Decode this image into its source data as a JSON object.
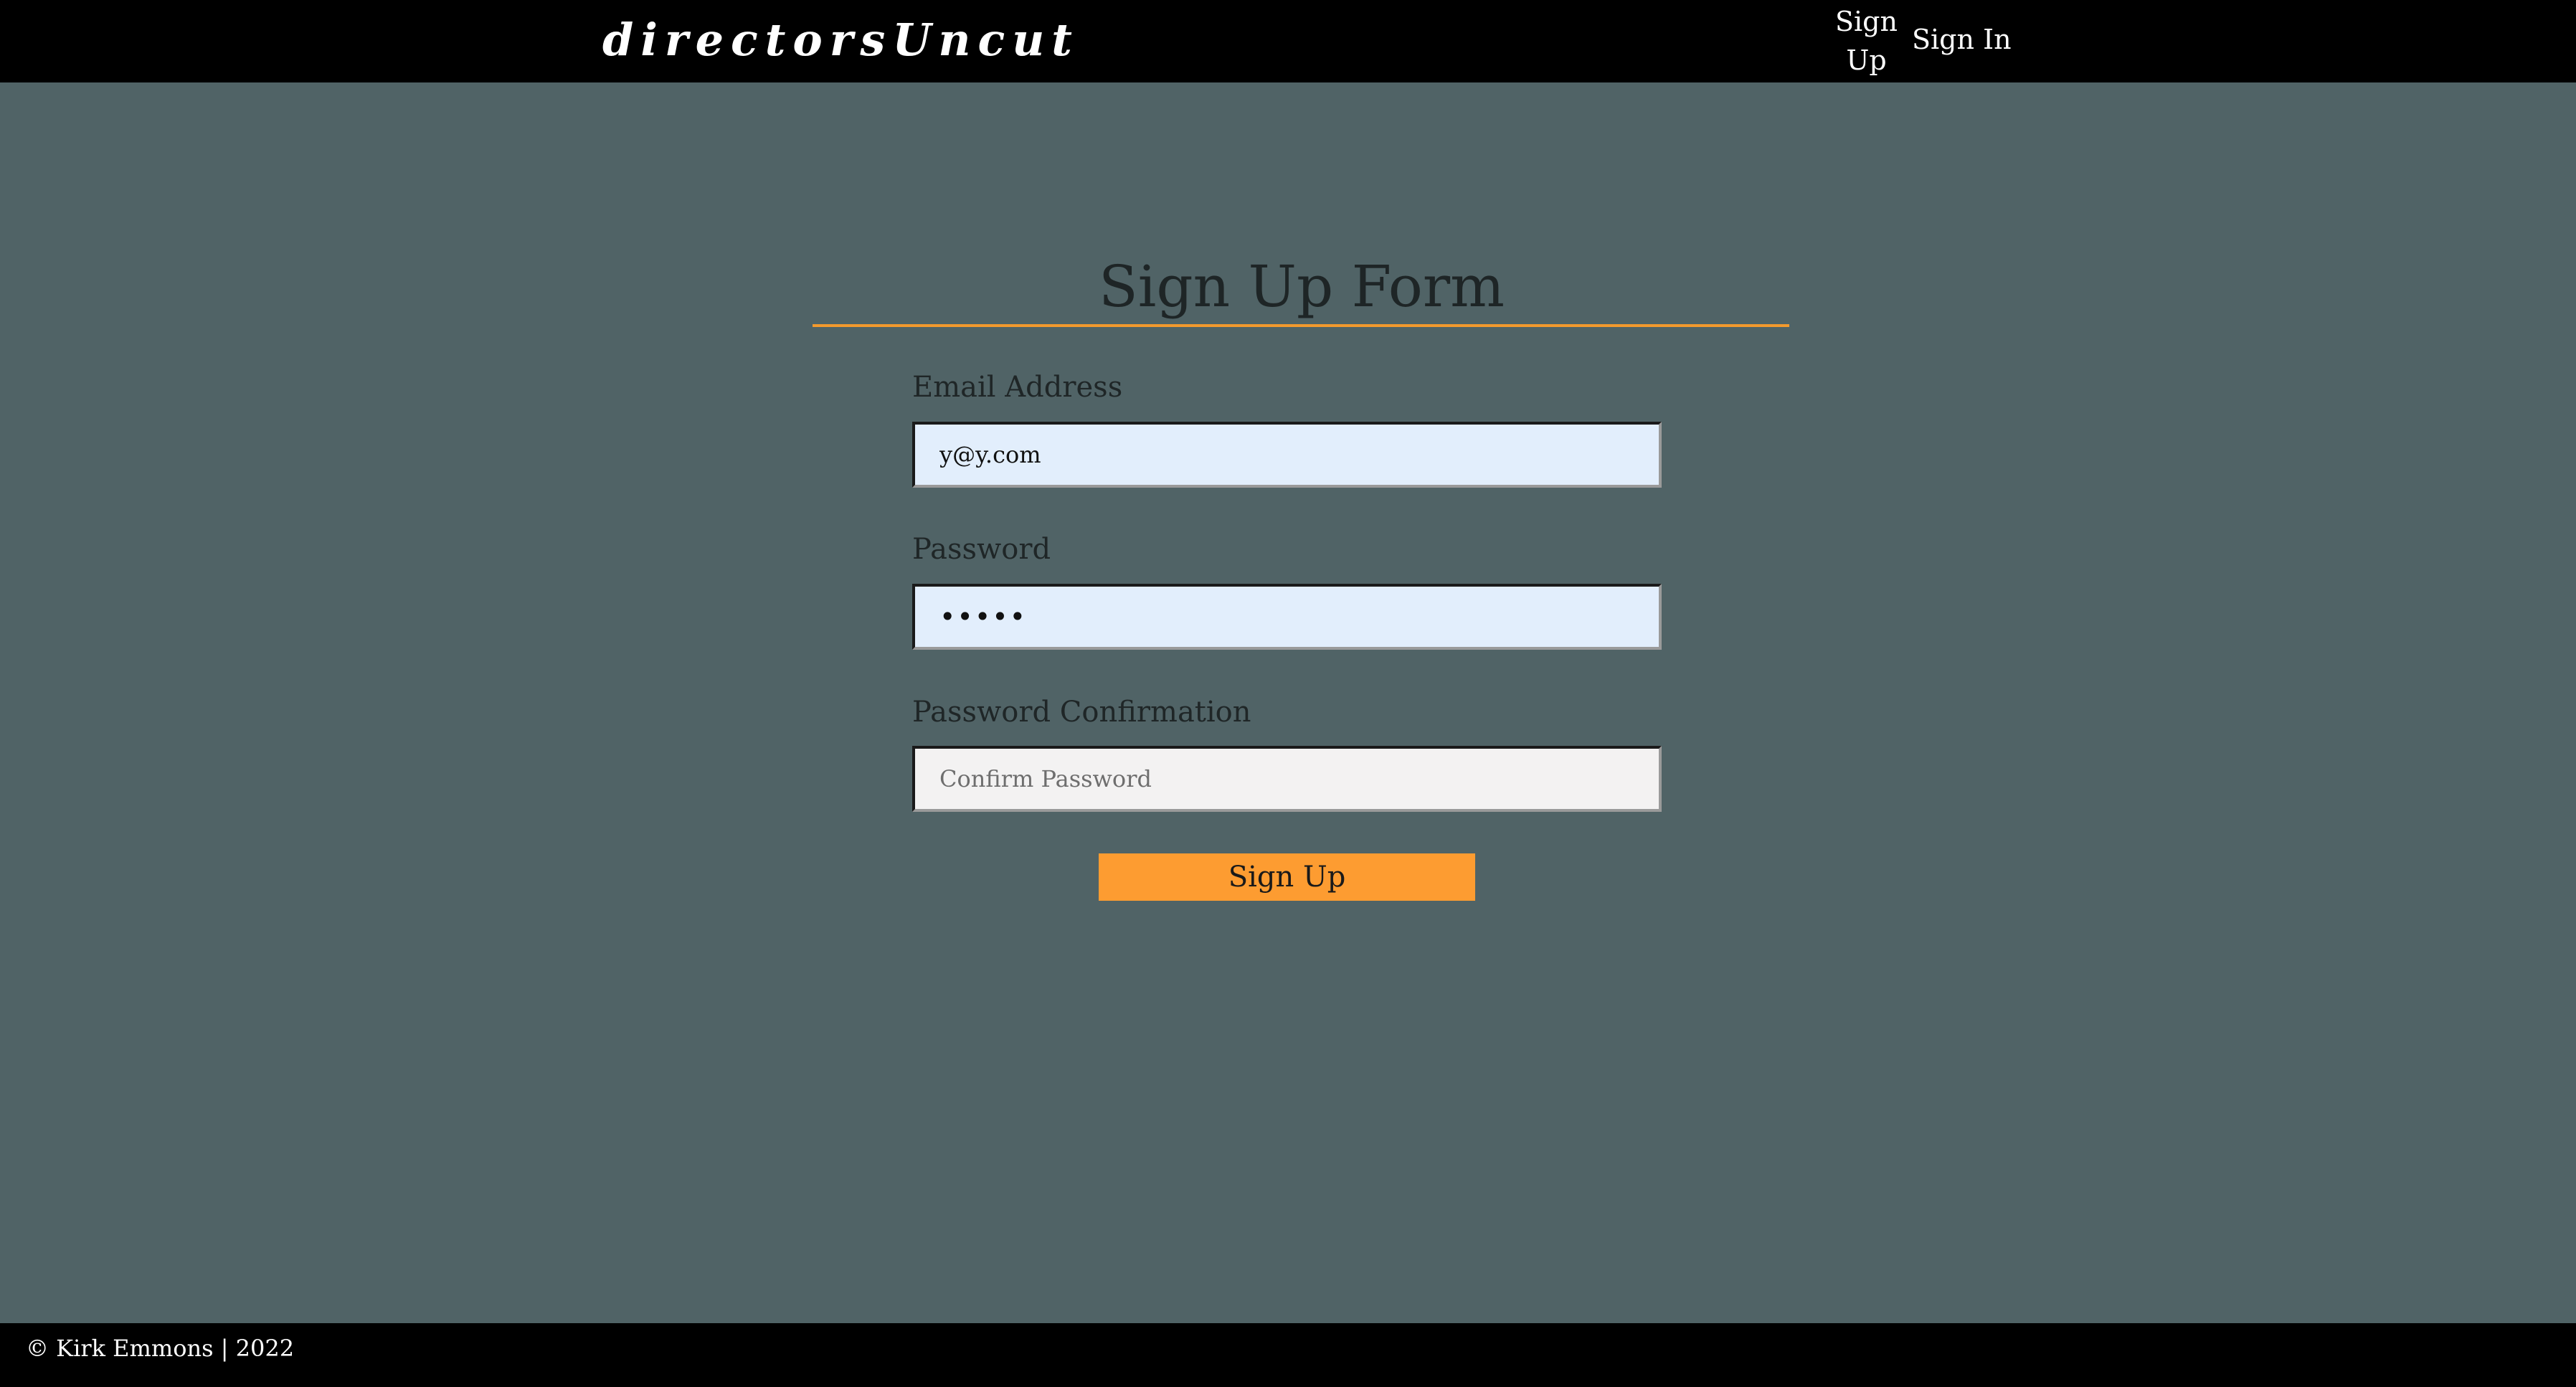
{
  "header": {
    "logo_text": "directorsUncut",
    "nav": {
      "signup_label": "Sign Up",
      "signin_label": "Sign In"
    }
  },
  "form": {
    "title": "Sign Up Form",
    "email": {
      "label": "Email Address",
      "value": "y@y.com"
    },
    "password": {
      "label": "Password",
      "value": "•••••"
    },
    "password_confirmation": {
      "label": "Password Confirmation",
      "value": "",
      "placeholder": "Confirm Password"
    },
    "submit_label": "Sign Up"
  },
  "footer": {
    "text": "© Kirk Emmons | 2022"
  },
  "colors": {
    "page_bg": "#506366",
    "bar_bg": "#000000",
    "accent": "#fd9c31",
    "autofill_bg": "#e2eefc",
    "input_bg": "#f3f2f2"
  }
}
